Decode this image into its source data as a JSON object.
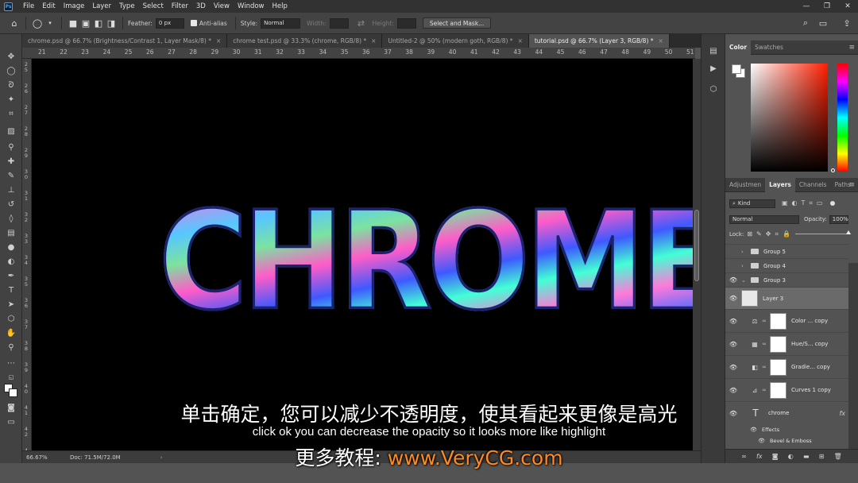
{
  "app": {
    "logo": "Ps"
  },
  "menu": [
    "File",
    "Edit",
    "Image",
    "Layer",
    "Type",
    "Select",
    "Filter",
    "3D",
    "View",
    "Window",
    "Help"
  ],
  "window_controls": [
    "—",
    "❐",
    "✕"
  ],
  "options": {
    "feather_label": "Feather:",
    "feather_value": "0 px",
    "antialias_label": "Anti-alias",
    "style_label": "Style:",
    "style_value": "Normal",
    "width_label": "Width:",
    "height_label": "Height:",
    "select_mask_label": "Select and Mask..."
  },
  "tabs": [
    {
      "label": "chrome.psd @ 66.7% (Brightness/Contrast 1, Layer Mask/8) *",
      "active": false
    },
    {
      "label": "chrome test.psd @ 33.3% (chrome, RGB/8) *",
      "active": false
    },
    {
      "label": "Untitled-2 @ 50% (modern goth, RGB/8) *",
      "active": false
    },
    {
      "label": "tutorial.psd @ 66.7% (Layer 3, RGB/8) *",
      "active": true
    }
  ],
  "ruler_top": [
    "21",
    "22",
    "23",
    "24",
    "25",
    "26",
    "27",
    "28",
    "29",
    "30",
    "31",
    "32",
    "33",
    "34",
    "35",
    "36",
    "37",
    "38",
    "39",
    "40",
    "41",
    "42",
    "43",
    "44",
    "45",
    "46",
    "47",
    "48",
    "49",
    "50",
    "51"
  ],
  "ruler_left": [
    "25",
    "26",
    "27",
    "28",
    "29",
    "30",
    "31",
    "32",
    "33",
    "34",
    "35",
    "36",
    "37",
    "38",
    "39",
    "40",
    "41",
    "42",
    "43"
  ],
  "canvas": {
    "artwork_text": "CHROME"
  },
  "status": {
    "zoom": "66.67%",
    "doc": "Doc: 71.5M/72.0M"
  },
  "subtitles": {
    "cn": "单击确定，您可以减少不透明度，使其看起来更像是高光",
    "en": "click ok you can decrease the opacity so it looks more like highlight",
    "more_prefix": "更多教程: ",
    "more_url": "www.VeryCG.com"
  },
  "color_panel": {
    "tabs": [
      "Color",
      "Swatches"
    ],
    "active": "Color",
    "hue_color": "#ff1e00"
  },
  "layers_panel": {
    "tabs": [
      "Adjustmen",
      "Layers",
      "Channels",
      "Paths"
    ],
    "active": "Layers",
    "kind_label": "Kind",
    "blend_mode": "Normal",
    "opacity_label": "Opacity:",
    "opacity_value": "100%",
    "lock_label": "Lock:",
    "layers": [
      {
        "name": "Group 5",
        "type": "group",
        "visible": false
      },
      {
        "name": "Group 4",
        "type": "group",
        "visible": false
      },
      {
        "name": "Group 3",
        "type": "group",
        "visible": true
      },
      {
        "name": "Layer 3",
        "type": "pixel",
        "visible": true,
        "selected": true
      },
      {
        "name": "Color ... copy",
        "type": "adjustment",
        "visible": true
      },
      {
        "name": "Hue/S... copy",
        "type": "adjustment",
        "visible": true
      },
      {
        "name": "Gradie... copy",
        "type": "adjustment",
        "visible": true
      },
      {
        "name": "Curves 1 copy",
        "type": "adjustment",
        "visible": true
      },
      {
        "name": "chrome",
        "type": "text",
        "visible": true
      },
      {
        "name": "Effects",
        "type": "effects",
        "visible": true
      },
      {
        "name": "Bevel & Emboss",
        "type": "effect",
        "visible": true
      }
    ]
  }
}
